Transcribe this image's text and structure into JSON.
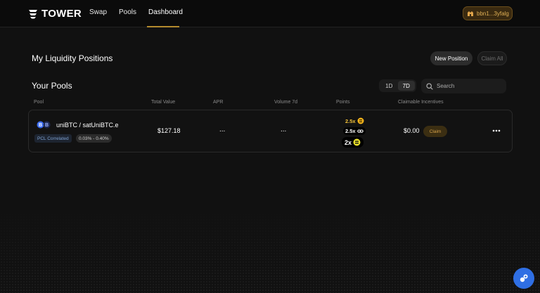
{
  "header": {
    "brand": "TOWER",
    "nav": [
      {
        "label": "Swap",
        "active": false
      },
      {
        "label": "Pools",
        "active": false
      },
      {
        "label": "Dashboard",
        "active": true
      }
    ],
    "wallet_address": "bbn1...3yfalg",
    "accent_color": "#b38a2e"
  },
  "positions": {
    "title": "My Liquidity Positions",
    "new_position_label": "New Position",
    "claim_all_label": "Claim All"
  },
  "pools": {
    "title": "Your Pools",
    "range_options": [
      "1D",
      "7D"
    ],
    "selected_range": "7D",
    "search_placeholder": "Search",
    "columns": [
      "Pool",
      "Total Value",
      "APR",
      "Volume 7d",
      "Points",
      "Claimable Incentives"
    ],
    "rows": [
      {
        "pair": "uniBTC / satUniBTC.e",
        "type_badge": "PCL Correlated",
        "fee_range": "0.03% - 0.40%",
        "total_value": "$127.18",
        "apr": "...",
        "volume_7d": "...",
        "points": [
          {
            "multiplier": "2.5x",
            "icon": "yellow-coin-icon"
          },
          {
            "multiplier": "2.5x",
            "icon": "link-icon"
          },
          {
            "multiplier": "2x",
            "icon": "green-coin-icon"
          }
        ],
        "claimable": "$0.00",
        "claim_label": "Claim"
      }
    ]
  }
}
